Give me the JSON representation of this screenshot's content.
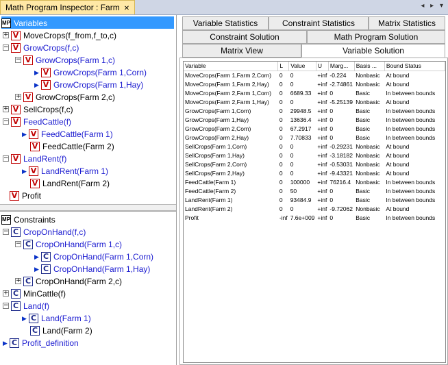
{
  "window": {
    "title": "Math Program Inspector : Farm",
    "close": "✕",
    "controls": "◂ ▸ ▾"
  },
  "variables": {
    "root": "Variables",
    "items": [
      "MoveCrops(f_from,f_to,c)",
      "GrowCrops(f,c)",
      "GrowCrops(Farm 1,c)",
      "GrowCrops(Farm 1,Corn)",
      "GrowCrops(Farm 1,Hay)",
      "GrowCrops(Farm 2,c)",
      "SellCrops(f,c)",
      "FeedCattle(f)",
      "FeedCattle(Farm 1)",
      "FeedCattle(Farm 2)",
      "LandRent(f)",
      "LandRent(Farm 1)",
      "LandRent(Farm 2)",
      "Profit"
    ]
  },
  "constraints": {
    "root": "Constraints",
    "items": [
      "CropOnHand(f,c)",
      "CropOnHand(Farm 1,c)",
      "CropOnHand(Farm 1,Corn)",
      "CropOnHand(Farm 1,Hay)",
      "CropOnHand(Farm 2,c)",
      "MinCattle(f)",
      "Land(f)",
      "Land(Farm 1)",
      "Land(Farm 2)",
      "Profit_definition"
    ]
  },
  "tabs": {
    "row1": [
      "Variable Statistics",
      "Constraint Statistics",
      "Matrix Statistics"
    ],
    "row2": [
      "Constraint Solution",
      "Math Program Solution"
    ],
    "row3": [
      "Matrix View",
      "Variable Solution"
    ],
    "active": "Variable Solution"
  },
  "table": {
    "columns": [
      "Variable",
      "L",
      "Value",
      "U",
      "Marg...",
      "Basis ...",
      "Bound Status"
    ],
    "rows": [
      [
        "MoveCrops(Farm 1,Farm 2,Corn)",
        "0",
        "0",
        "+inf",
        "-0.224",
        "Nonbasic",
        "At bound"
      ],
      [
        "MoveCrops(Farm 1,Farm 2,Hay)",
        "0",
        "0",
        "+inf",
        "-2.74861",
        "Nonbasic",
        "At bound"
      ],
      [
        "MoveCrops(Farm 2,Farm 1,Corn)",
        "0",
        "6689.33",
        "+inf",
        "0",
        "Basic",
        "In between bounds"
      ],
      [
        "MoveCrops(Farm 2,Farm 1,Hay)",
        "0",
        "0",
        "+inf",
        "-5.25139",
        "Nonbasic",
        "At bound"
      ],
      [
        "GrowCrops(Farm 1,Corn)",
        "0",
        "29948.5",
        "+inf",
        "0",
        "Basic",
        "In between bounds"
      ],
      [
        "GrowCrops(Farm 1,Hay)",
        "0",
        "13636.4",
        "+inf",
        "0",
        "Basic",
        "In between bounds"
      ],
      [
        "GrowCrops(Farm 2,Corn)",
        "0",
        "67.2917",
        "+inf",
        "0",
        "Basic",
        "In between bounds"
      ],
      [
        "GrowCrops(Farm 2,Hay)",
        "0",
        "7.70833",
        "+inf",
        "0",
        "Basic",
        "In between bounds"
      ],
      [
        "SellCrops(Farm 1,Corn)",
        "0",
        "0",
        "+inf",
        "-0.29231",
        "Nonbasic",
        "At bound"
      ],
      [
        "SellCrops(Farm 1,Hay)",
        "0",
        "0",
        "+inf",
        "-3.18182",
        "Nonbasic",
        "At bound"
      ],
      [
        "SellCrops(Farm 2,Corn)",
        "0",
        "0",
        "+inf",
        "-0.53031",
        "Nonbasic",
        "At bound"
      ],
      [
        "SellCrops(Farm 2,Hay)",
        "0",
        "0",
        "+inf",
        "-9.43321",
        "Nonbasic",
        "At bound"
      ],
      [
        "FeedCattle(Farm 1)",
        "0",
        "100000",
        "+inf",
        "76216.4",
        "Nonbasic",
        "In between bounds"
      ],
      [
        "FeedCattle(Farm 2)",
        "0",
        "50",
        "+inf",
        "0",
        "Basic",
        "In between bounds"
      ],
      [
        "LandRent(Farm 1)",
        "0",
        "93484.9",
        "+inf",
        "0",
        "Basic",
        "In between bounds"
      ],
      [
        "LandRent(Farm 2)",
        "0",
        "0",
        "+inf",
        "-9.72062",
        "Nonbasic",
        "At bound"
      ],
      [
        "Profit",
        "-inf",
        "7.6e+009",
        "+inf",
        "0",
        "Basic",
        "In between bounds"
      ]
    ]
  }
}
